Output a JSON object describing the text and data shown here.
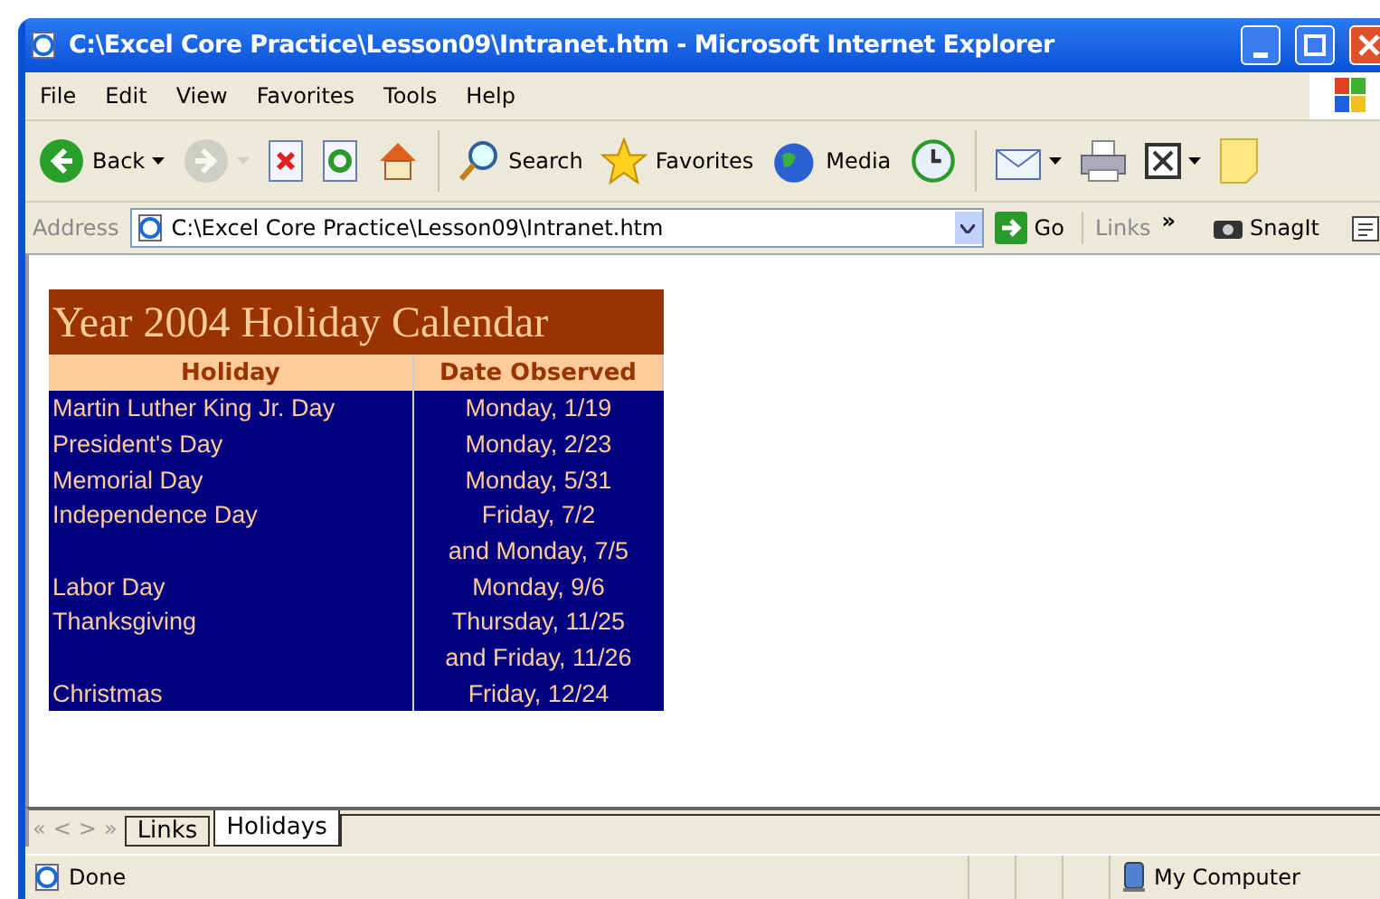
{
  "window": {
    "title": "C:\\Excel Core Practice\\Lesson09\\Intranet.htm - Microsoft Internet Explorer"
  },
  "menu": [
    "File",
    "Edit",
    "View",
    "Favorites",
    "Tools",
    "Help"
  ],
  "toolbar": [
    {
      "kind": "back",
      "label": "Back",
      "dropdown": true,
      "disabled": false
    },
    {
      "kind": "forward",
      "dropdown": true,
      "disabled": true
    },
    {
      "kind": "stop",
      "disabled": false
    },
    {
      "kind": "refresh",
      "disabled": false
    },
    {
      "kind": "home",
      "disabled": false
    },
    {
      "kind": "separator"
    },
    {
      "kind": "search",
      "label": "Search",
      "disabled": false
    },
    {
      "kind": "favorites",
      "label": "Favorites",
      "disabled": false
    },
    {
      "kind": "media",
      "label": "Media",
      "disabled": false
    },
    {
      "kind": "history",
      "disabled": false
    },
    {
      "kind": "separator"
    },
    {
      "kind": "mail",
      "dropdown": true,
      "disabled": false
    },
    {
      "kind": "print",
      "disabled": false
    },
    {
      "kind": "edit",
      "dropdown": true,
      "disabled": false
    },
    {
      "kind": "note",
      "disabled": false
    }
  ],
  "address": {
    "label": "Address",
    "value": "C:\\Excel Core Practice\\Lesson09\\Intranet.htm",
    "go": "Go",
    "links": "Links",
    "chevron": "»",
    "snagit": "SnagIt"
  },
  "table": {
    "title": "Year 2004 Holiday Calendar",
    "columns": [
      "Holiday",
      "Date Observed"
    ],
    "rows": [
      {
        "holiday": "Martin Luther King Jr. Day",
        "date": "Monday, 1/19"
      },
      {
        "holiday": "President's Day",
        "date": "Monday, 2/23"
      },
      {
        "holiday": "Memorial Day",
        "date": "Monday, 5/31"
      },
      {
        "holiday": "Independence Day",
        "date": "Friday, 7/2"
      },
      {
        "date": "and Monday, 7/5"
      },
      {
        "holiday": "Labor Day",
        "date": "Monday, 9/6"
      },
      {
        "holiday": "Thanksgiving",
        "date": "Thursday, 11/25"
      },
      {
        "date": "and Friday, 11/26"
      },
      {
        "holiday": "Christmas",
        "date": "Friday, 12/24"
      }
    ]
  },
  "sheet_nav": [
    "«",
    "<",
    ">",
    "»"
  ],
  "sheet_tabs": [
    {
      "label": "Links",
      "selected": false
    },
    {
      "label": "Holidays",
      "selected": true
    }
  ],
  "status_bar": {
    "text": "Done",
    "zone": "My Computer"
  }
}
